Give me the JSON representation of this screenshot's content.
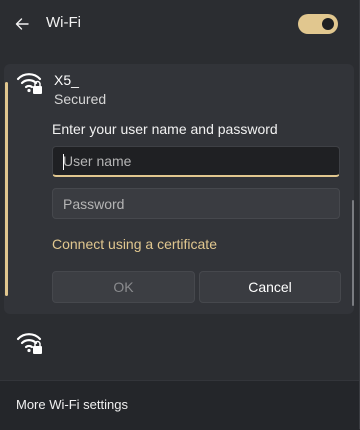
{
  "header": {
    "title": "Wi-Fi",
    "back_icon": "arrow-left-icon",
    "wifi_toggle": "on"
  },
  "active_network": {
    "name": "X5_",
    "status": "Secured",
    "icon": "wifi-secured-icon",
    "prompt": "Enter your user name and password",
    "username_placeholder": "User name",
    "username_value": "",
    "password_placeholder": "Password",
    "password_value": "",
    "certificate_link": "Connect using a certificate",
    "ok_label": "OK",
    "cancel_label": "Cancel"
  },
  "other_networks": [
    {
      "icon": "wifi-secured-icon"
    }
  ],
  "footer": {
    "more_settings_label": "More Wi-Fi settings"
  },
  "colors": {
    "accent": "#e1c78f",
    "background": "#2b2d31"
  }
}
